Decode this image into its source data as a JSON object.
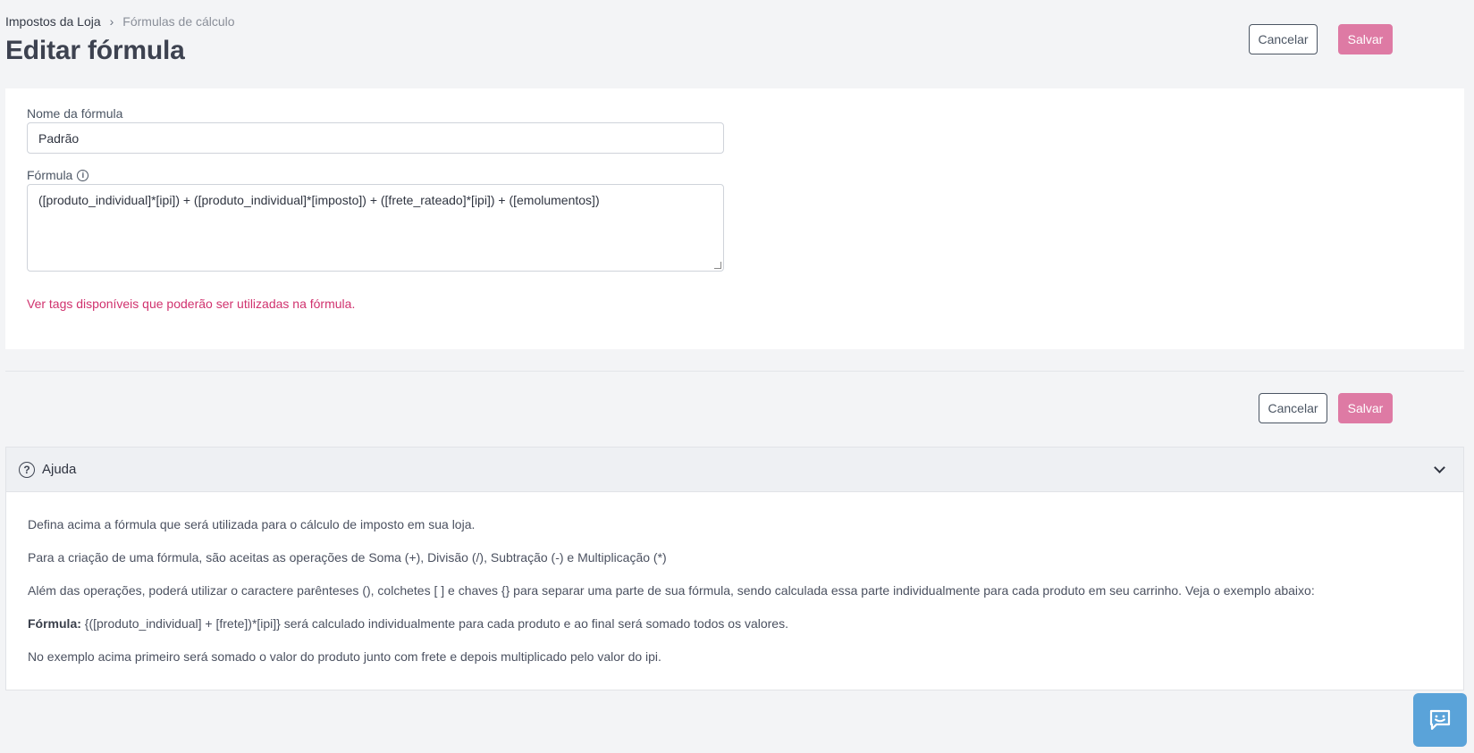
{
  "breadcrumb": {
    "parent": "Impostos da Loja",
    "separator": "›",
    "current": "Fórmulas de cálculo"
  },
  "page": {
    "title": "Editar fórmula"
  },
  "header_actions": {
    "cancel_label": "Cancelar",
    "save_label": "Salvar"
  },
  "form": {
    "name_label": "Nome da fórmula",
    "name_value": "Padrão",
    "formula_label": "Fórmula",
    "formula_info_icon": "info-icon",
    "formula_value": "([produto_individual]*[ipi]) + ([produto_individual]*[imposto]) + ([frete_rateado]*[ipi]) + ([emolumentos])",
    "tags_link": "Ver tags disponíveis que poderão ser utilizadas na fórmula."
  },
  "footer_actions": {
    "cancel_label": "Cancelar",
    "save_label": "Salvar"
  },
  "help": {
    "title": "Ajuda",
    "icon": "question-circle-icon",
    "lines": [
      "Defina acima a fórmula que será utilizada para o cálculo de imposto em sua loja.",
      "Para a criação de uma fórmula, são aceitas as operações de Soma (+), Divisão (/), Subtração (-) e Multiplicação (*)",
      "Além das operações, poderá utilizar o caractere parênteses (), colchetes [ ] e chaves {} para separar uma parte de sua fórmula, sendo calculada essa parte individualmente para cada produto em seu carrinho. Veja o exemplo abaixo:"
    ],
    "example_label": "Fórmula:",
    "example_text": " {([produto_individual] + [frete])*[ipi]} será calculado individualmente para cada produto e ao final será somado todos os valores.",
    "closing": "No exemplo acima primeiro será somado o valor do produto junto com frete e depois multiplicado pelo valor do ipi."
  },
  "colors": {
    "primary": "#de7aa4",
    "link": "#d0326e",
    "chat": "#5aa3d9"
  },
  "chat_widget": {
    "icon": "chat-icon"
  }
}
